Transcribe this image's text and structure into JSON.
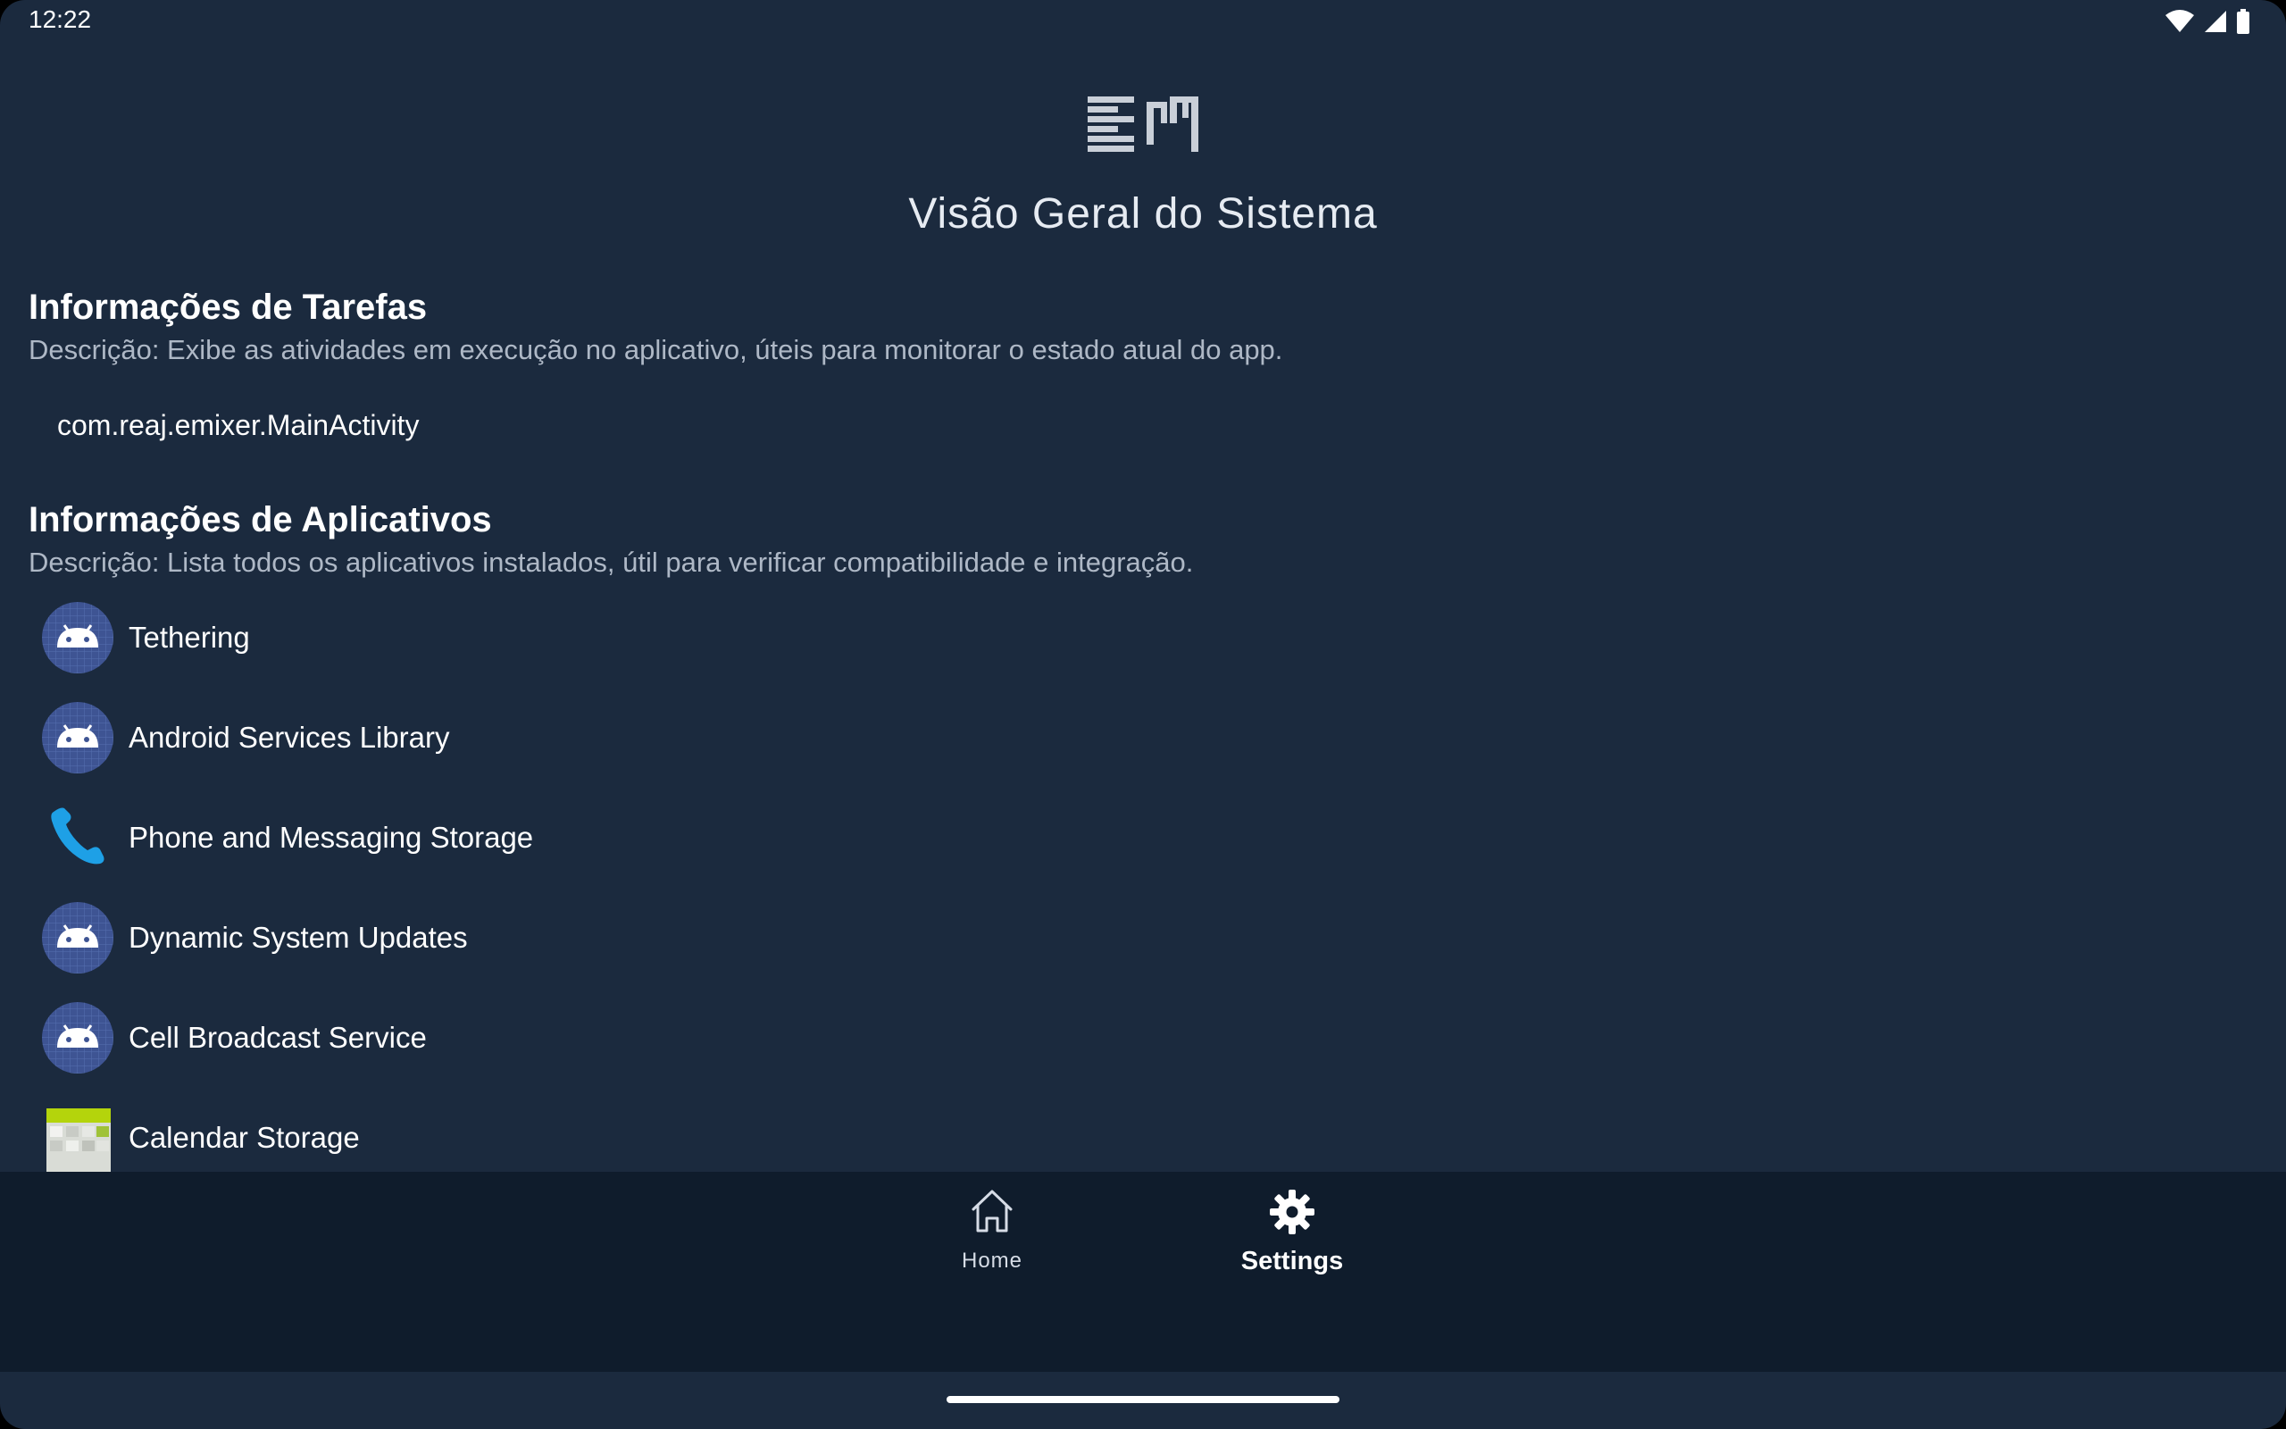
{
  "status_bar": {
    "time": "12:22",
    "icons": [
      "wifi-icon",
      "signal-icon",
      "battery-icon"
    ]
  },
  "header": {
    "logo": "EM",
    "title": "Visão Geral do Sistema"
  },
  "tasks_section": {
    "title": "Informações de Tarefas",
    "description": "Descrição: Exibe as atividades em execução no aplicativo, úteis para monitorar o estado atual do app.",
    "items": [
      "com.reaj.emixer.MainActivity"
    ]
  },
  "apps_section": {
    "title": "Informações de Aplicativos",
    "description": "Descrição: Lista todos os aplicativos instalados, útil para verificar compatibilidade e integração.",
    "items": [
      {
        "label": "Tethering",
        "icon": "android-icon"
      },
      {
        "label": "Android Services Library",
        "icon": "android-icon"
      },
      {
        "label": "Phone and Messaging Storage",
        "icon": "phone-icon"
      },
      {
        "label": "Dynamic System Updates",
        "icon": "android-icon"
      },
      {
        "label": "Cell Broadcast Service",
        "icon": "android-icon"
      },
      {
        "label": "Calendar Storage",
        "icon": "calendar-icon"
      }
    ]
  },
  "bottom_nav": {
    "home_label": "Home",
    "settings_label": "Settings",
    "selected": "Settings"
  },
  "colors": {
    "background": "#1b2a3e",
    "nav_background": "#0f1c2c",
    "android_icon_bg": "#3e5493",
    "phone_icon": "#1ea0e6",
    "description_text": "#aeb8c6"
  }
}
